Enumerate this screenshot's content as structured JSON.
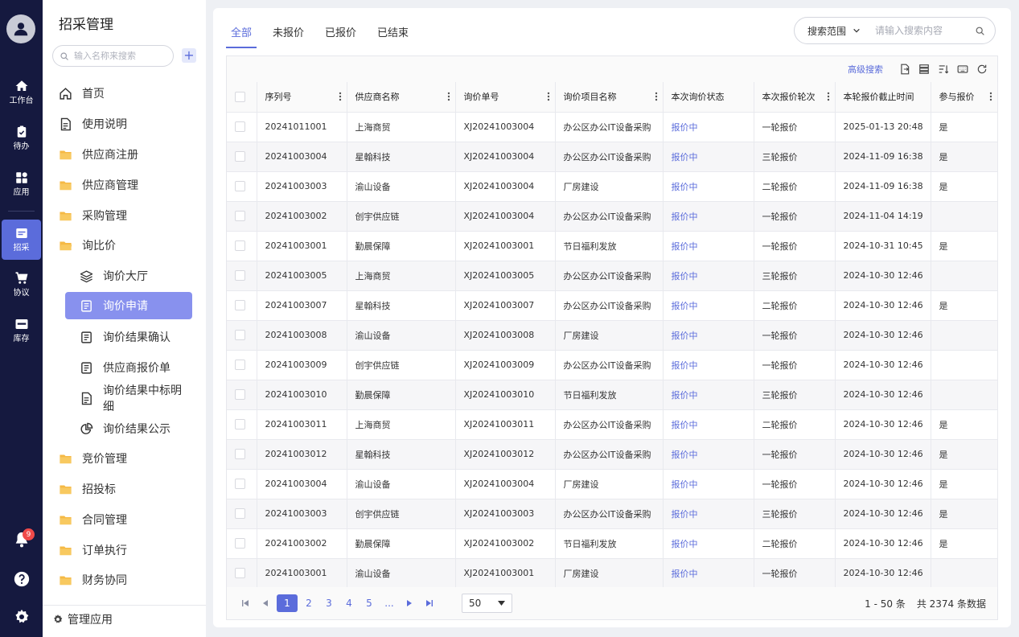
{
  "rail": {
    "items": [
      {
        "label": "工作台",
        "icon": "home-icon"
      },
      {
        "label": "待办",
        "icon": "clipboard-icon"
      },
      {
        "label": "应用",
        "icon": "apps-icon"
      },
      {
        "label": "招采",
        "icon": "procurement-icon"
      },
      {
        "label": "协议",
        "icon": "cart-icon"
      },
      {
        "label": "库存",
        "icon": "wms-icon"
      }
    ],
    "notifications": "9"
  },
  "menu": {
    "title": "招采管理",
    "search_placeholder": "输入名称来搜索",
    "items": [
      {
        "label": "首页"
      },
      {
        "label": "使用说明"
      },
      {
        "label": "供应商注册"
      },
      {
        "label": "供应商管理"
      },
      {
        "label": "采购管理"
      },
      {
        "label": "询比价"
      },
      {
        "label": "询价大厅"
      },
      {
        "label": "询价申请"
      },
      {
        "label": "询价结果确认"
      },
      {
        "label": "供应商报价单"
      },
      {
        "label": "询价结果中标明细"
      },
      {
        "label": "询价结果公示"
      },
      {
        "label": "竞价管理"
      },
      {
        "label": "招投标"
      },
      {
        "label": "合同管理"
      },
      {
        "label": "订单执行"
      },
      {
        "label": "财务协同"
      }
    ],
    "manage": "管理应用"
  },
  "tabs": [
    "全部",
    "未报价",
    "已报价",
    "已结束"
  ],
  "search": {
    "scope": "搜索范围",
    "placeholder": "请输入搜索内容"
  },
  "toolbar": {
    "advanced": "高级搜索"
  },
  "table": {
    "headers": [
      "序列号",
      "供应商名称",
      "询价单号",
      "询价项目名称",
      "本次询价状态",
      "本次报价轮次",
      "本轮报价截止时间",
      "参与报价"
    ],
    "rows": [
      [
        "20241011001",
        "上海商贸",
        "XJ20241003004",
        "办公区办公IT设备采购",
        "报价中",
        "一轮报价",
        "2025-01-13 20:48",
        "是"
      ],
      [
        "20241003004",
        "星翰科技",
        "XJ20241003004",
        "办公区办公IT设备采购",
        "报价中",
        "三轮报价",
        "2024-11-09 16:38",
        "是"
      ],
      [
        "20241003003",
        "渝山设备",
        "XJ20241003004",
        "厂房建设",
        "报价中",
        "二轮报价",
        "2024-11-09 16:38",
        "是"
      ],
      [
        "20241003002",
        "创宇供应链",
        "XJ20241003004",
        "办公区办公IT设备采购",
        "报价中",
        "一轮报价",
        "2024-11-04 14:19",
        ""
      ],
      [
        "20241003001",
        "勤晨保障",
        "XJ20241003001",
        "节日福利发放",
        "报价中",
        "一轮报价",
        "2024-10-31 10:45",
        "是"
      ],
      [
        "20241003005",
        "上海商贸",
        "XJ20241003005",
        "办公区办公IT设备采购",
        "报价中",
        "三轮报价",
        "2024-10-30 12:46",
        ""
      ],
      [
        "20241003007",
        "星翰科技",
        "XJ20241003007",
        "办公区办公IT设备采购",
        "报价中",
        "二轮报价",
        "2024-10-30 12:46",
        "是"
      ],
      [
        "20241003008",
        "渝山设备",
        "XJ20241003008",
        "厂房建设",
        "报价中",
        "一轮报价",
        "2024-10-30 12:46",
        ""
      ],
      [
        "20241003009",
        "创宇供应链",
        "XJ20241003009",
        "办公区办公IT设备采购",
        "报价中",
        "一轮报价",
        "2024-10-30 12:46",
        ""
      ],
      [
        "20241003010",
        "勤晨保障",
        "XJ20241003010",
        "节日福利发放",
        "报价中",
        "三轮报价",
        "2024-10-30 12:46",
        ""
      ],
      [
        "20241003011",
        "上海商贸",
        "XJ20241003011",
        "办公区办公IT设备采购",
        "报价中",
        "二轮报价",
        "2024-10-30 12:46",
        "是"
      ],
      [
        "20241003012",
        "星翰科技",
        "XJ20241003012",
        "办公区办公IT设备采购",
        "报价中",
        "一轮报价",
        "2024-10-30 12:46",
        "是"
      ],
      [
        "20241003004",
        "渝山设备",
        "XJ20241003004",
        "厂房建设",
        "报价中",
        "一轮报价",
        "2024-10-30 12:46",
        "是"
      ],
      [
        "20241003003",
        "创宇供应链",
        "XJ20241003003",
        "办公区办公IT设备采购",
        "报价中",
        "三轮报价",
        "2024-10-30 12:46",
        "是"
      ],
      [
        "20241003002",
        "勤晨保障",
        "XJ20241003002",
        "节日福利发放",
        "报价中",
        "二轮报价",
        "2024-10-30 12:46",
        "是"
      ],
      [
        "20241003001",
        "渝山设备",
        "XJ20241003001",
        "厂房建设",
        "报价中",
        "一轮报价",
        "2024-10-30 12:46",
        ""
      ]
    ]
  },
  "pager": {
    "pages": [
      "1",
      "2",
      "3",
      "4",
      "5",
      "..."
    ],
    "current": "1",
    "page_size": "50",
    "range": "1 - 50 条",
    "total": "共 2374 条数据"
  },
  "colors": {
    "accent": "#5b6cdb",
    "rail": "#15193f",
    "active_menu": "#8891ee",
    "folder": "#f5b945"
  }
}
